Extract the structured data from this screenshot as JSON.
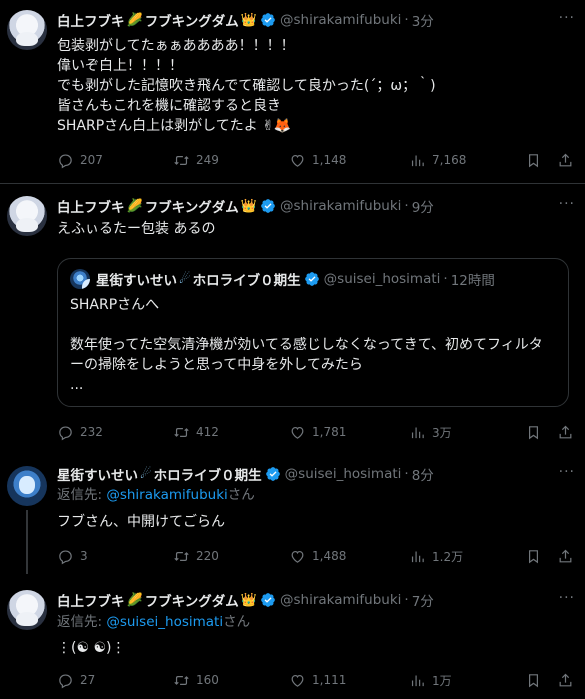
{
  "tweets": [
    {
      "author": {
        "name": "白上フブキ",
        "emoji": [
          "🌽",
          "👑"
        ],
        "name2": "フブキングダム",
        "handle": "@shirakamifubuki",
        "time": "3分"
      },
      "text": "包装剥がしてたぁぁああああ！！！！\n偉いぞ白上！！！！\nでも剥がした記憶吹き飛んでて確認して良かった(´；ω；｀)\n皆さんもこれを機に確認すると良き\nSHARPさん白上は剥がしてたよ ✌🦊",
      "stats": {
        "replies": "207",
        "retweets": "249",
        "likes": "1,148",
        "views": "7,168"
      }
    },
    {
      "author": {
        "name": "白上フブキ",
        "emoji": [
          "🌽",
          "👑"
        ],
        "name2": "フブキングダム",
        "handle": "@shirakamifubuki",
        "time": "9分"
      },
      "text": "えふぃるたー包装 あるの",
      "quote": {
        "name": "星街すいせい",
        "emoji": "☄",
        "name2": "ホロライブ０期生",
        "handle": "@suisei_hosimati",
        "time": "12時間",
        "text": "SHARPさんへ\n\n数年使ってた空気清浄機が効いてる感じしなくなってきて、初めてフィルターの掃除をしようと思って中身を外してみたら\n..."
      },
      "stats": {
        "replies": "232",
        "retweets": "412",
        "likes": "1,781",
        "views": "3万"
      }
    },
    {
      "author": {
        "name": "星街すいせい",
        "emoji": [
          "☄"
        ],
        "name2": "ホロライブ０期生",
        "handle": "@suisei_hosimati",
        "time": "8分"
      },
      "reply_to": {
        "prefix": "返信先: ",
        "mention": "@shirakamifubuki",
        "suffix": "さん"
      },
      "text": "フブさん、中開けてごらん",
      "stats": {
        "replies": "3",
        "retweets": "220",
        "likes": "1,488",
        "views": "1.2万"
      }
    },
    {
      "author": {
        "name": "白上フブキ",
        "emoji": [
          "🌽",
          "👑"
        ],
        "name2": "フブキングダム",
        "handle": "@shirakamifubuki",
        "time": "7分"
      },
      "reply_to": {
        "prefix": "返信先: ",
        "mention": "@suisei_hosimati",
        "suffix": "さん"
      },
      "text": "⋮(☯︎ ☯︎)⋮",
      "stats": {
        "replies": "27",
        "retweets": "160",
        "likes": "1,111",
        "views": "1万"
      }
    }
  ],
  "ui": {
    "dot": "·",
    "more": "···"
  },
  "colors": {
    "background": "#000000",
    "text": "#e7e9ea",
    "muted": "#71767b",
    "accent": "#1d9bf0",
    "verified": "#1d9bf0",
    "border": "#2f3336"
  }
}
